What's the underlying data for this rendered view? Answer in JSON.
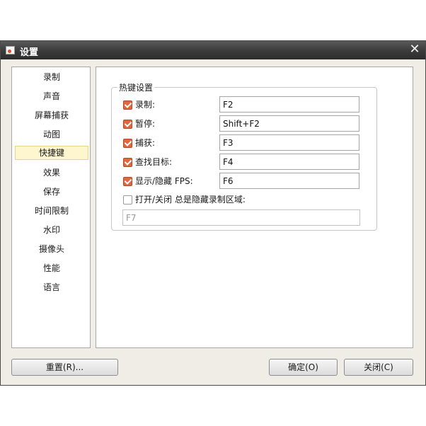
{
  "window": {
    "title": "设置",
    "close_glyph": "✕",
    "icons": {
      "app": "app-icon",
      "close": "close-icon"
    }
  },
  "sidebar": {
    "items": [
      {
        "label": "录制",
        "active": false
      },
      {
        "label": "声音",
        "active": false
      },
      {
        "label": "屏幕捕获",
        "active": false
      },
      {
        "label": "动图",
        "active": false
      },
      {
        "label": "快捷键",
        "active": true
      },
      {
        "label": "效果",
        "active": false
      },
      {
        "label": "保存",
        "active": false
      },
      {
        "label": "时间限制",
        "active": false
      },
      {
        "label": "水印",
        "active": false
      },
      {
        "label": "摄像头",
        "active": false
      },
      {
        "label": "性能",
        "active": false
      },
      {
        "label": "语言",
        "active": false
      }
    ]
  },
  "hotkeys": {
    "group_title": "热键设置",
    "rows": [
      {
        "label": "录制:",
        "checked": true,
        "value": "F2"
      },
      {
        "label": "暂停:",
        "checked": true,
        "value": "Shift+F2"
      },
      {
        "label": "捕获:",
        "checked": true,
        "value": "F3"
      },
      {
        "label": "查找目标:",
        "checked": true,
        "value": "F4"
      },
      {
        "label": "显示/隐藏 FPS:",
        "checked": true,
        "value": "F6"
      }
    ],
    "toggle_area": {
      "label": "打开/关闭 总是隐藏录制区域:",
      "checked": false,
      "value": "F7"
    }
  },
  "footer": {
    "reset_label": "重置(R)...",
    "ok_label": "确定(O)",
    "close_label": "关闭(C)"
  },
  "colors": {
    "checkbox_checked": "#e0683e",
    "active_item_bg": "#fdf6cf",
    "titlebar": "#3a3a3a"
  }
}
